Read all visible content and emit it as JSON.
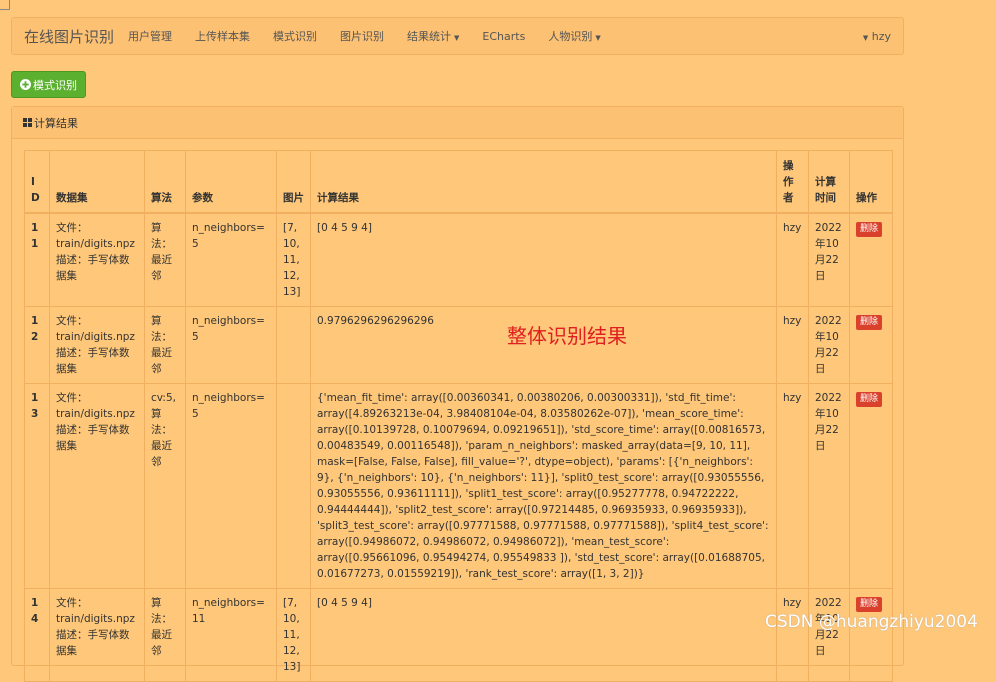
{
  "navbar": {
    "brand": "在线图片识别",
    "items": [
      {
        "label": "用户管理",
        "dropdown": false
      },
      {
        "label": "上传样本集",
        "dropdown": false
      },
      {
        "label": "模式识别",
        "dropdown": false
      },
      {
        "label": "图片识别",
        "dropdown": false
      },
      {
        "label": "结果统计",
        "dropdown": true
      },
      {
        "label": "ECharts",
        "dropdown": false
      },
      {
        "label": "人物识别",
        "dropdown": true
      }
    ],
    "user": "hzy"
  },
  "actions": {
    "pattern_button": "模式识别"
  },
  "panel": {
    "title": "计算结果"
  },
  "table": {
    "headers": [
      "ID",
      "数据集",
      "算法",
      "参数",
      "图片",
      "计算结果",
      "操作者",
      "计算时间",
      "操作"
    ],
    "rows": [
      {
        "id": "11",
        "dataset": "文件：train/digits.npz 描述：手写体数据集",
        "algo": "算法：最近邻",
        "param": "n_neighbors=5",
        "image": "[7, 10, 11, 12, 13]",
        "result": "[0 4 5 9 4]",
        "operator": "hzy",
        "time": "2022年10月22日",
        "action": "删除"
      },
      {
        "id": "12",
        "dataset": "文件：train/digits.npz 描述：手写体数据集",
        "algo": "算法：最近邻",
        "param": "n_neighbors=5",
        "image": "",
        "result": "0.9796296296296296",
        "operator": "hzy",
        "time": "2022年10月22日",
        "action": "删除"
      },
      {
        "id": "13",
        "dataset": "文件：train/digits.npz 描述：手写体数据集",
        "algo": "cv:5, 算法：最近邻",
        "param": "n_neighbors=5",
        "image": "",
        "result": "{'mean_fit_time': array([0.00360341, 0.00380206, 0.00300331]), 'std_fit_time': array([4.89263213e-04, 3.98408104e-04, 8.03580262e-07]), 'mean_score_time': array([0.10139728, 0.10079694, 0.09219651]), 'std_score_time': array([0.00816573, 0.00483549, 0.00116548]), 'param_n_neighbors': masked_array(data=[9, 10, 11], mask=[False, False, False], fill_value='?', dtype=object), 'params': [{'n_neighbors': 9}, {'n_neighbors': 10}, {'n_neighbors': 11}], 'split0_test_score': array([0.93055556, 0.93055556, 0.93611111]), 'split1_test_score': array([0.95277778, 0.94722222, 0.94444444]), 'split2_test_score': array([0.97214485, 0.96935933, 0.96935933]), 'split3_test_score': array([0.97771588, 0.97771588, 0.97771588]), 'split4_test_score': array([0.94986072, 0.94986072, 0.94986072]), 'mean_test_score': array([0.95661096, 0.95494274, 0.95549833 ]), 'std_test_score': array([0.01688705, 0.01677273, 0.01559219]), 'rank_test_score': array([1, 3, 2])}",
        "operator": "hzy",
        "time": "2022年10月22日",
        "action": "删除"
      },
      {
        "id": "14",
        "dataset": "文件：train/digits.npz 描述：手写体数据集",
        "algo": "算法：最近邻",
        "param": "n_neighbors=11",
        "image": "[7, 10, 11, 12, 13]",
        "result": "[0 4 5 9 4]",
        "operator": "hzy",
        "time": "2022年10月22日",
        "action": "删除"
      }
    ]
  },
  "overlay_annotation": "整体识别结果",
  "watermark": "CSDN @huangzhiyu2004",
  "colors": {
    "background": "#fec779",
    "success": "#5cb030",
    "danger": "#d9412d",
    "annotation": "#e02020"
  }
}
